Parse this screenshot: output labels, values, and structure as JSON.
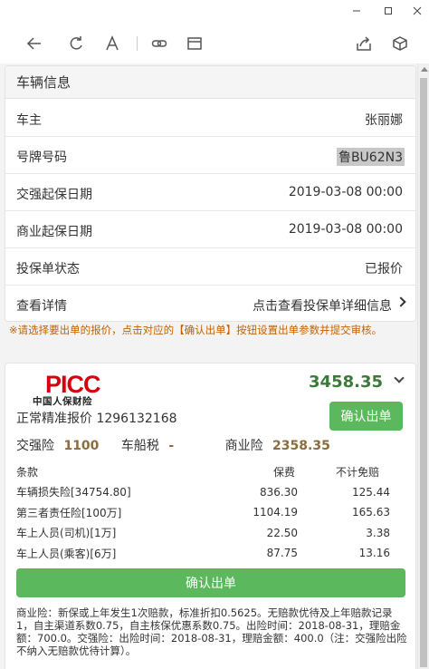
{
  "window": {
    "minimize_icon": "minimize-icon",
    "maximize_icon": "maximize-icon",
    "close_icon": "close-icon"
  },
  "toolbar": {
    "icons": [
      "back-arrow-icon",
      "refresh-icon",
      "font-icon",
      "link-icon",
      "window-icon",
      "share-icon",
      "cube-icon"
    ]
  },
  "vehicle": {
    "title": "车辆信息",
    "rows": [
      {
        "label": "车主",
        "value": "张丽娜"
      },
      {
        "label": "号牌号码",
        "value": "鲁BU62N3"
      },
      {
        "label": "交强起保日期",
        "value": "2019-03-08 00:00"
      },
      {
        "label": "商业起保日期",
        "value": "2019-03-08 00:00"
      },
      {
        "label": "投保单状态",
        "value": "已报价"
      },
      {
        "label": "查看详情",
        "value": "点击查看投保单详细信息"
      }
    ]
  },
  "notice": "※请选择要出单的报价，点击对应的【确认出单】按钮设置出单参数并提交审核。",
  "quote": {
    "logo_en": "PICC",
    "logo_cn": "中国人保财险",
    "total": "3458.35",
    "confirm_label": "确认出单",
    "type_label": "正常精准报价",
    "quote_no": "1296132168",
    "jq_label": "交强险",
    "jq_value": "1100",
    "ccs_label": "车船税",
    "ccs_value": "-",
    "sy_label": "商业险",
    "sy_value": "2358.35",
    "table": {
      "headers": [
        "条款",
        "保费",
        "不计免赔"
      ],
      "rows": [
        [
          "车辆损失险[34754.80]",
          "836.30",
          "125.44"
        ],
        [
          "第三者责任险[100万]",
          "1104.19",
          "165.63"
        ],
        [
          "车上人员(司机)[1万]",
          "22.50",
          "3.38"
        ],
        [
          "车上人员(乘客)[6万]",
          "87.75",
          "13.16"
        ]
      ]
    },
    "confirm_wide_label": "确认出单",
    "footnote": "商业险：新保或上年发生1次赔款，标准折扣0.5625。无赔款优待及上年赔款记录1，自主渠道系数0.75，自主核保优惠系数0.75。出险时间：2018-08-31，理赔金额：700.0。交强险：出险时间：2018-08-31，理赔金额：400.0（注：交强险出险不纳入无赔款优待计算）。"
  },
  "colors": {
    "accent_green": "#5cb85c",
    "price_green": "#3c7a3c",
    "notice_orange": "#c46200",
    "picc_red": "#d7000f"
  }
}
